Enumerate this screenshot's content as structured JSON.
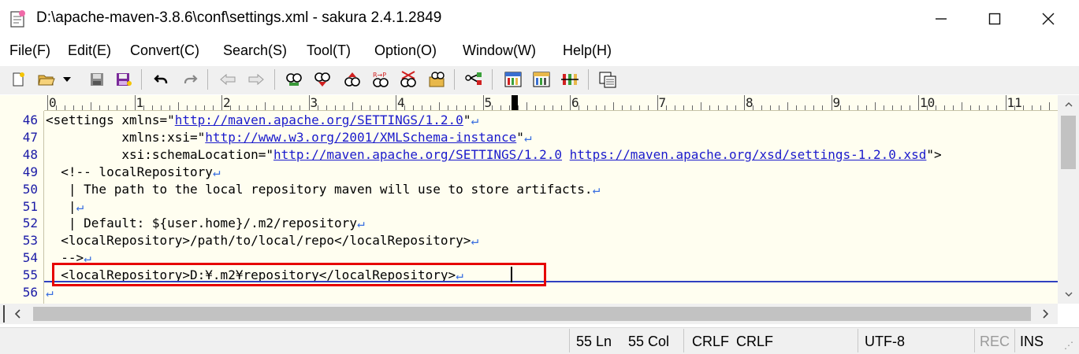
{
  "window": {
    "title": "D:\\apache-maven-3.8.6\\conf\\settings.xml - sakura 2.4.1.2849",
    "minimize_glyph": "—",
    "maximize_glyph": "☐",
    "close_glyph": "✕"
  },
  "menu": [
    {
      "label": "File(F)",
      "id": "file"
    },
    {
      "label": "Edit(E)",
      "id": "edit"
    },
    {
      "label": "Convert(C)",
      "id": "convert"
    },
    {
      "label": "Search(S)",
      "id": "search"
    },
    {
      "label": "Tool(T)",
      "id": "tool"
    },
    {
      "label": "Option(O)",
      "id": "option"
    },
    {
      "label": "Window(W)",
      "id": "window"
    },
    {
      "label": "Help(H)",
      "id": "help"
    }
  ],
  "toolbar": {
    "icons": [
      "new-file-icon",
      "open-folder-icon",
      "dropdown-arrow-icon",
      "save-icon",
      "save-all-icon",
      "undo-icon",
      "redo-icon",
      "jump-back-icon",
      "jump-forward-icon",
      "search-icon",
      "search-next-icon",
      "search-prev-icon",
      "replace-icon",
      "clear-search-icon",
      "grep-icon",
      "tag-jump-icon",
      "settings-common-icon",
      "settings-type-icon",
      "settings-font-icon",
      "window-list-icon"
    ]
  },
  "ruler": {
    "numbers": [
      "0",
      "1",
      "2",
      "3",
      "4",
      "5",
      "6",
      "7",
      "8",
      "9",
      "10",
      "11"
    ]
  },
  "editor": {
    "lines": [
      {
        "num": "46",
        "parts": [
          {
            "t": "<settings xmlns=\""
          },
          {
            "t": "http://maven.apache.org/SETTINGS/1.2.0",
            "url": true
          },
          {
            "t": "\""
          },
          {
            "t": "↵",
            "nl": true
          }
        ]
      },
      {
        "num": "47",
        "parts": [
          {
            "t": "          xmlns:xsi=\""
          },
          {
            "t": "http://www.w3.org/2001/XMLSchema-instance",
            "url": true
          },
          {
            "t": "\""
          },
          {
            "t": "↵",
            "nl": true
          }
        ]
      },
      {
        "num": "48",
        "parts": [
          {
            "t": "          xsi:schemaLocation=\""
          },
          {
            "t": "http://maven.apache.org/SETTINGS/1.2.0",
            "url": true
          },
          {
            "t": " "
          },
          {
            "t": "https://maven.apache.org/xsd/settings-1.2.0.xsd",
            "url": true
          },
          {
            "t": "\">"
          }
        ]
      },
      {
        "num": "49",
        "parts": [
          {
            "t": "  <!-- localRepository"
          },
          {
            "t": "↵",
            "nl": true
          }
        ]
      },
      {
        "num": "50",
        "parts": [
          {
            "t": "   | The path to the local repository maven will use to store artifacts."
          },
          {
            "t": "↵",
            "nl": true
          }
        ]
      },
      {
        "num": "51",
        "parts": [
          {
            "t": "   |"
          },
          {
            "t": "↵",
            "nl": true
          }
        ]
      },
      {
        "num": "52",
        "parts": [
          {
            "t": "   | Default: ${user.home}/.m2/repository"
          },
          {
            "t": "↵",
            "nl": true
          }
        ]
      },
      {
        "num": "53",
        "parts": [
          {
            "t": "  <localRepository>/path/to/local/repo</localRepository>"
          },
          {
            "t": "↵",
            "nl": true
          }
        ]
      },
      {
        "num": "54",
        "parts": [
          {
            "t": "  -->"
          },
          {
            "t": "↵",
            "nl": true
          }
        ]
      },
      {
        "num": "55",
        "parts": [
          {
            "t": "  <localRepository>D:¥.m2¥repository</localRepository>"
          },
          {
            "t": "↵",
            "nl": true
          }
        ]
      },
      {
        "num": "56",
        "parts": [
          {
            "t": "↵",
            "nl": true
          }
        ]
      }
    ]
  },
  "status": {
    "line": "55 Ln",
    "col": "55 Col",
    "eol1": "CRLF",
    "eol2": "CRLF",
    "encoding": "UTF-8",
    "rec": "REC",
    "ins": "INS"
  },
  "colors": {
    "editor_bg": "#fffef0",
    "line_number": "#1a1aa6",
    "url": "#1a1acc",
    "newline_mark": "#3a6fe0",
    "highlight_box": "#e60000",
    "cursor_line": "#3040c0"
  }
}
